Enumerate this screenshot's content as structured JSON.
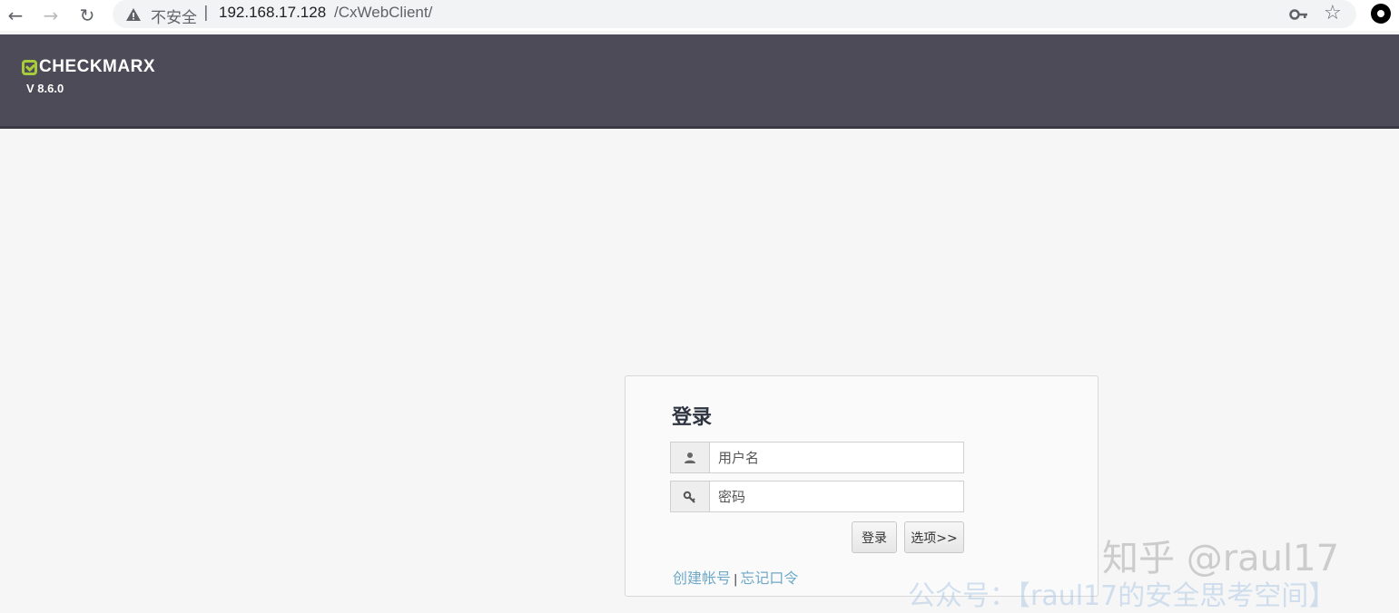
{
  "browser": {
    "nav": {
      "back": "←",
      "forward": "→",
      "reload": "↻"
    },
    "security_label": "不安全",
    "url_separator": "|",
    "url_host": "192.168.17.128",
    "url_path": "/CxWebClient/",
    "icons": [
      "arrow-left-icon",
      "arrow-right-icon",
      "reload-icon",
      "warning-icon",
      "key-icon",
      "star-icon",
      "profile-icon"
    ]
  },
  "header": {
    "logo_text": "CHECKMARX",
    "version": "V 8.6.0",
    "background": "#4d4b57",
    "brand_accent": "#a7cb3a"
  },
  "login": {
    "title": "登录",
    "username_placeholder": "用户名",
    "password_placeholder": "密码",
    "login_button": "登录",
    "options_button": "选项>>",
    "create_account_link": "创建帐号",
    "link_separator": "|",
    "forgot_password_link": "忘记口令",
    "link_color": "#6fa8c8"
  },
  "watermarks": {
    "zhihu": "知乎 @raul17",
    "wechat": "公众号：【raul17的安全思考空间】"
  }
}
